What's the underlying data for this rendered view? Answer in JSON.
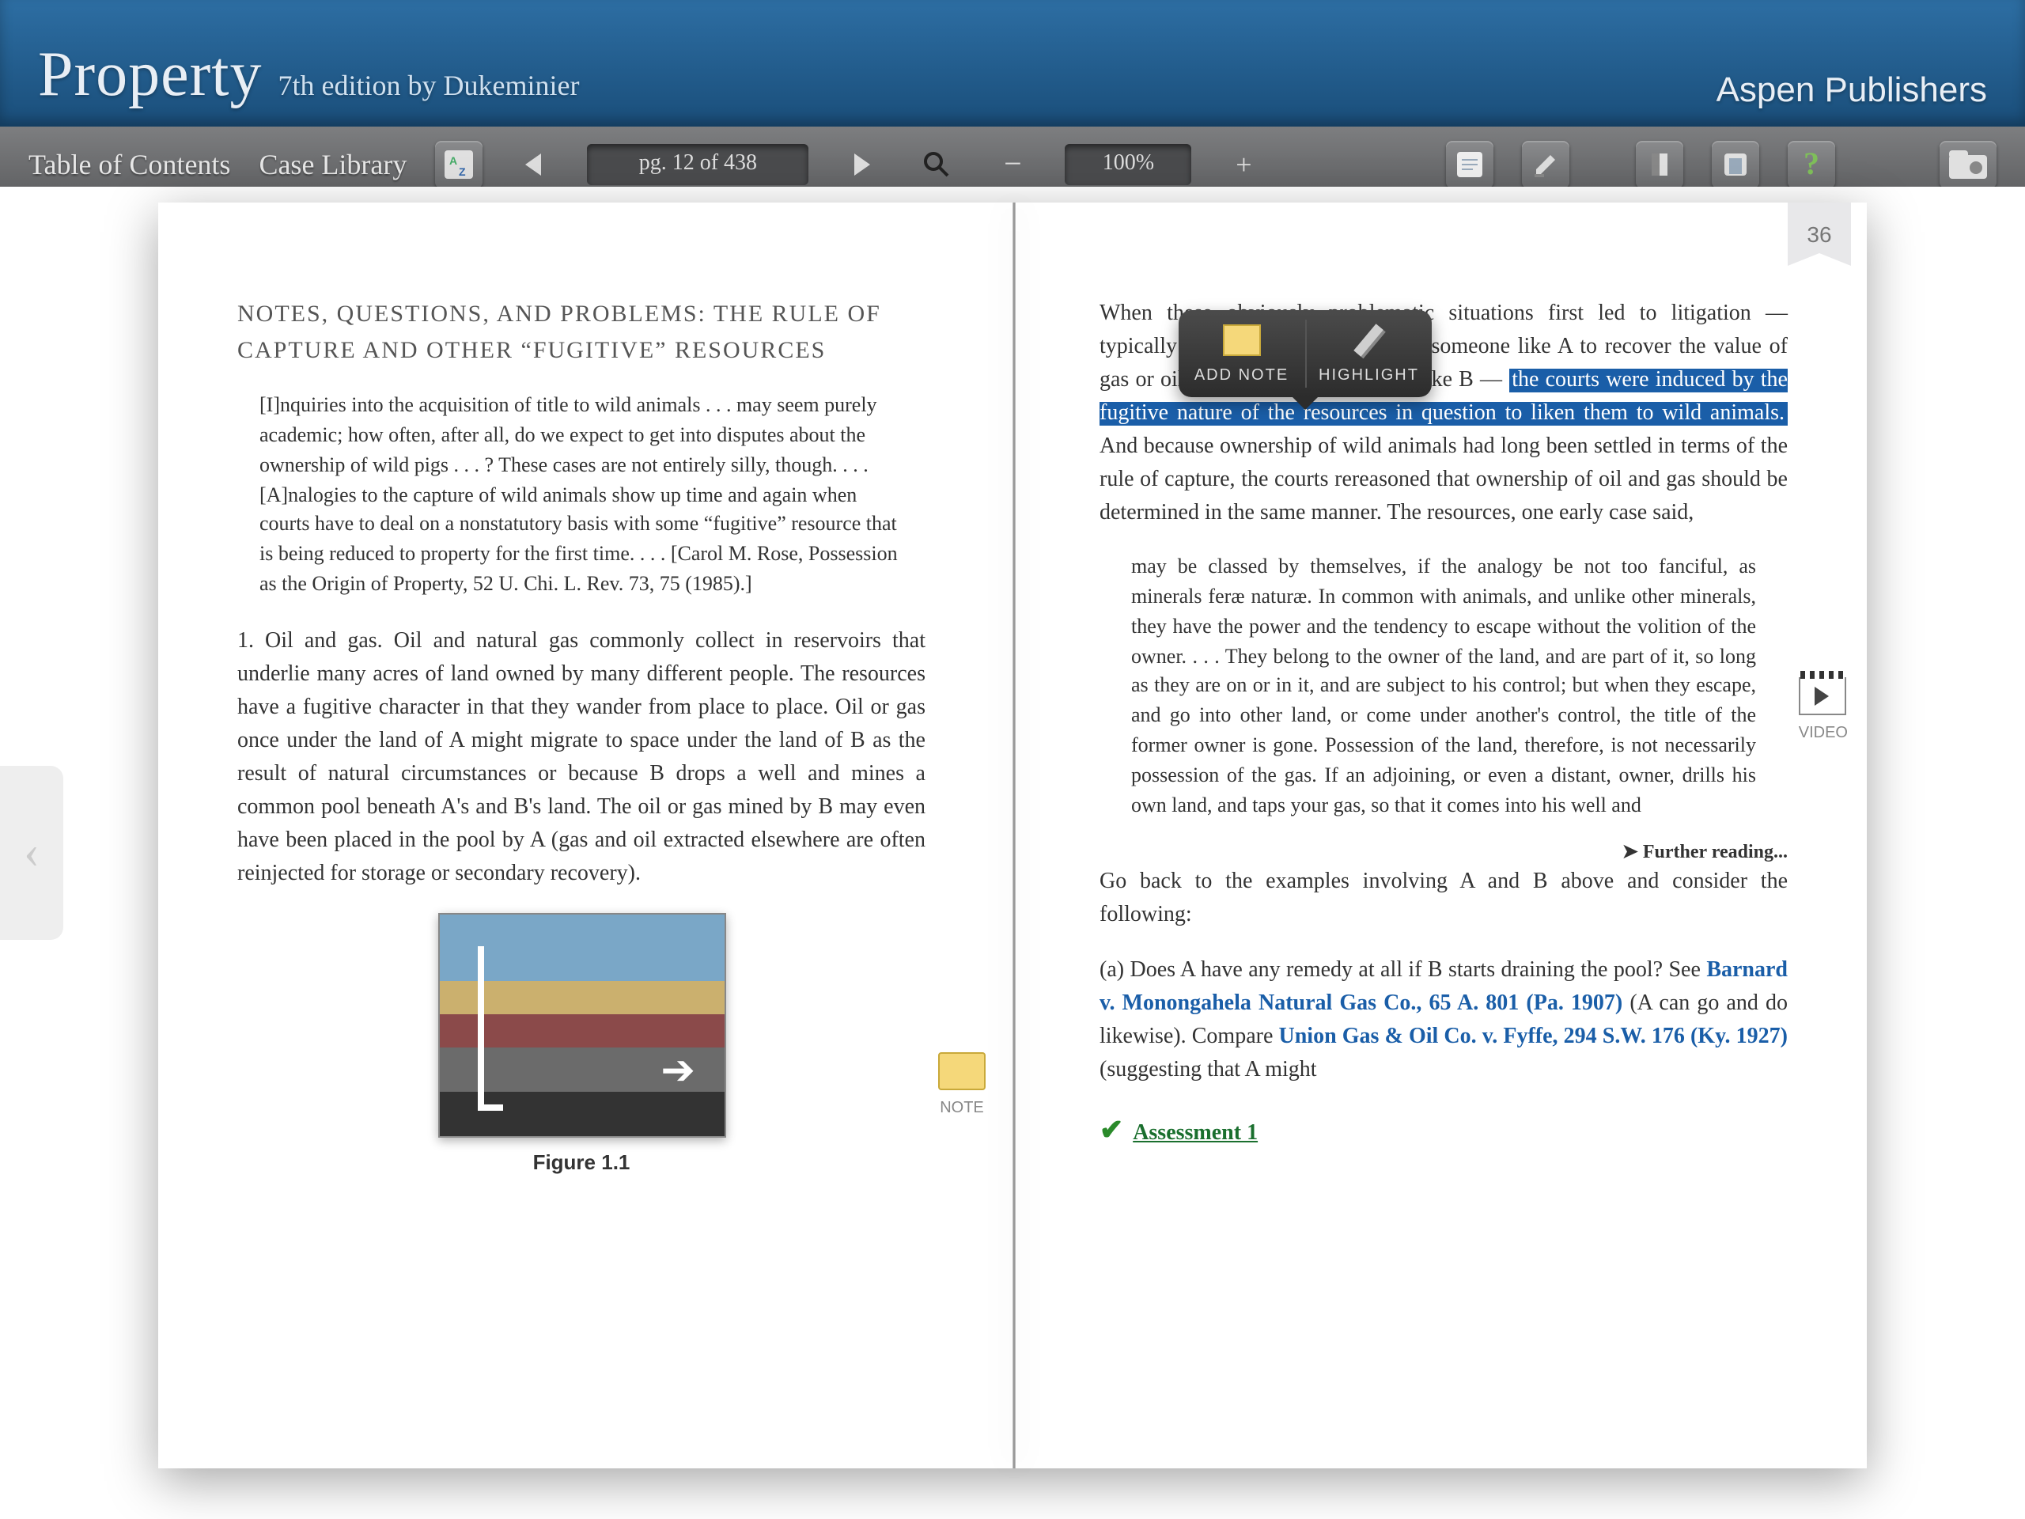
{
  "header": {
    "book_title": "Property",
    "edition_author": "7th edition by Dukeminier",
    "publisher": "Aspen Publishers"
  },
  "toolbar": {
    "toc": "Table of Contents",
    "case_library": "Case Library",
    "page_indicator": "pg. 12 of 438",
    "zoom": "100%",
    "icons": {
      "index": "index-az-icon",
      "prev": "prev-page-icon",
      "next": "next-page-icon",
      "search": "search-icon",
      "zoom_out": "zoom-out-icon",
      "zoom_in": "zoom-in-icon",
      "notes": "notes-icon",
      "highlighter": "highlighter-icon",
      "bookmark": "bookmark-icon",
      "print": "print-icon",
      "help": "help-icon",
      "library": "library-folder-icon"
    }
  },
  "popup": {
    "add_note": "ADD NOTE",
    "highlight": "HIGHLIGHT"
  },
  "bookmark_number": "36",
  "margin": {
    "note_label": "NOTE",
    "video_label": "VIDEO"
  },
  "left_page": {
    "heading": "NOTES, QUESTIONS, AND PROBLEMS: THE RULE OF CAPTURE AND OTHER “FUGITIVE” RESOURCES",
    "quote": "[I]nquiries into the acquisition of title to wild animals . . . may seem purely academic; how often, after all, do we expect to get into disputes about the ownership of wild pigs . . . ? These cases are not entirely silly, though. . . . [A]nalogies to the capture of wild animals show up time and again when courts have to deal on a nonstatutory basis with some “fugitive” resource that is being reduced to property for the first time. . . . [Carol M. Rose, Possession as the Origin of Property, 52 U. Chi. L. Rev. 73, 75 (1985).]",
    "body1": "1. Oil and gas. Oil and natural gas commonly collect in reservoirs that underlie many acres of land owned by many different people. The resources have a fugitive character in that they wander from place to place. Oil or gas once under the land of A might migrate to space under the land of B as the result of natural circumstances or because B drops a well and mines a common pool beneath A's and B's land. The oil or gas mined by B may even have been placed in the pool by A (gas and oil extracted elsewhere are often reinjected for storage or secondary recovery).",
    "figure_caption": "Figure 1.1"
  },
  "right_page": {
    "p1_pre": "When these obviously problematic situations first led to litigation — typically (and not always) a suit by someone like A to recover the value of gas or oil drawn away by someone like B — ",
    "p1_hl": "the courts were induced by the fugitive nature of the resources in question to liken them to wild animals.",
    "p1_post": " And because ownership of wild animals had long been settled in terms of the rule of capture, the courts rereasoned that ownership of oil and gas should be determined in the same manner. The resources, one early case said,",
    "quote": "may be classed by themselves, if the analogy be not too fanciful, as minerals feræ naturæ. In common with animals, and unlike other minerals, they have the power and the tendency to escape without the volition of the owner. . . . They belong to the owner of the land, and are part of it, so long as they are on or in it, and are subject to his control; but when they escape, and go into other land, or come under another's control, the title of the former owner is gone. Possession of the land, therefore, is not necessarily possession of the gas. If an adjoining, or even a distant, owner, drills his own land, and taps your gas, so that it comes into his well and",
    "further": "➤ Further reading...",
    "p2": "Go back to the examples involving A and B above and consider the following:",
    "p3a": "(a) Does A have any remedy at all if B starts draining the pool? See ",
    "case1": "Barnard v. Monongahela Natural Gas Co., 65 A. 801 (Pa. 1907)",
    "p3b": " (A can go and do likewise). Compare ",
    "case2": "Union Gas & Oil Co. v. Fyffe, 294 S.W. 176 (Ky. 1927)",
    "p3c": " (suggesting that A might",
    "assessment": "Assessment 1"
  }
}
